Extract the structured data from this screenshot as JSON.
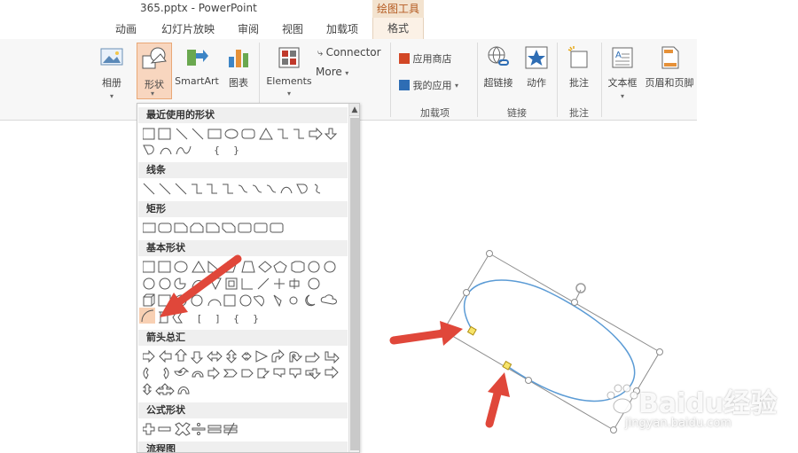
{
  "window": {
    "title": "365.pptx - PowerPoint",
    "tool_group": "绘图工具"
  },
  "tabs": [
    {
      "label": "动画"
    },
    {
      "label": "幻灯片放映"
    },
    {
      "label": "审阅"
    },
    {
      "label": "视图"
    },
    {
      "label": "加载项"
    },
    {
      "label": "格式"
    }
  ],
  "ribbon": {
    "album": "相册",
    "shapes": "形状",
    "smartart": "SmartArt",
    "chart": "图表",
    "elements": "Elements",
    "connector": "Connector",
    "more": "More",
    "app_store": "应用商店",
    "my_apps": "我的应用",
    "addins_group": "加载项",
    "hyperlink": "超链接",
    "action": "动作",
    "links_group": "链接",
    "comment": "批注",
    "comments_group": "批注",
    "textbox": "文本框",
    "header_footer": "页眉和页脚"
  },
  "shapes_panel": {
    "sections": [
      {
        "title": "最近使用的形状"
      },
      {
        "title": "线条"
      },
      {
        "title": "矩形"
      },
      {
        "title": "基本形状"
      },
      {
        "title": "箭头总汇"
      },
      {
        "title": "公式形状"
      },
      {
        "title": "流程图"
      }
    ]
  },
  "watermark": {
    "main": "Baidu经验",
    "sub": "jingyan.baidu.com"
  },
  "colors": {
    "accent": "#d24726",
    "arrow": "#e0473a",
    "ellipse": "#5b9bd5",
    "handle": "#f7e46a"
  }
}
